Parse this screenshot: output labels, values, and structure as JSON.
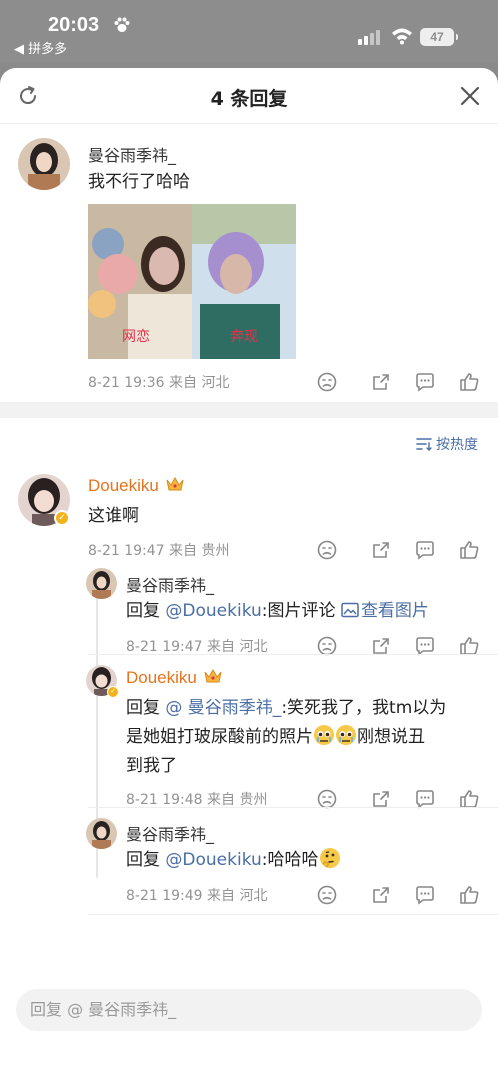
{
  "status": {
    "time": "20:03",
    "back_app": "◀ 拼多多",
    "battery": "47"
  },
  "sheet": {
    "title": "4 条回复"
  },
  "main_comment": {
    "name": "曼谷雨季祎_",
    "text": "我不行了哈哈",
    "image_labels": [
      "网恋",
      "奔现"
    ],
    "meta": "8-21 19:36  来自 河北"
  },
  "sort": {
    "label": "按热度"
  },
  "replies": [
    {
      "name": "Douekiku",
      "text": "这谁啊",
      "meta": "8-21 19:47  来自 贵州"
    },
    {
      "name": "曼谷雨季祎_",
      "prefix": "回复 ",
      "mention": "@Douekiku",
      "text": ":图片评论 ",
      "link": "查看图片",
      "meta": "8-21 19:47  来自 河北"
    },
    {
      "name": "Douekiku",
      "prefix": "回复 ",
      "mention": "@ 曼谷雨季祎_",
      "line1": ":笑死我了，我tm以为",
      "line2": "是她姐打玻尿酸前的照片",
      "line2b": "刚想说丑",
      "line3": "到我了",
      "meta": "8-21 19:48  来自 贵州"
    },
    {
      "name": "曼谷雨季祎_",
      "prefix": "回复 ",
      "mention": "@Douekiku",
      "text": ":哈哈哈",
      "meta": "8-21 19:49  来自 河北"
    }
  ],
  "input": {
    "placeholder": "回复 @ 曼谷雨季祎_"
  },
  "colors": {
    "accent": "#4a6ea5",
    "vip_name": "#e8731c",
    "badge": "#f2b31a"
  }
}
